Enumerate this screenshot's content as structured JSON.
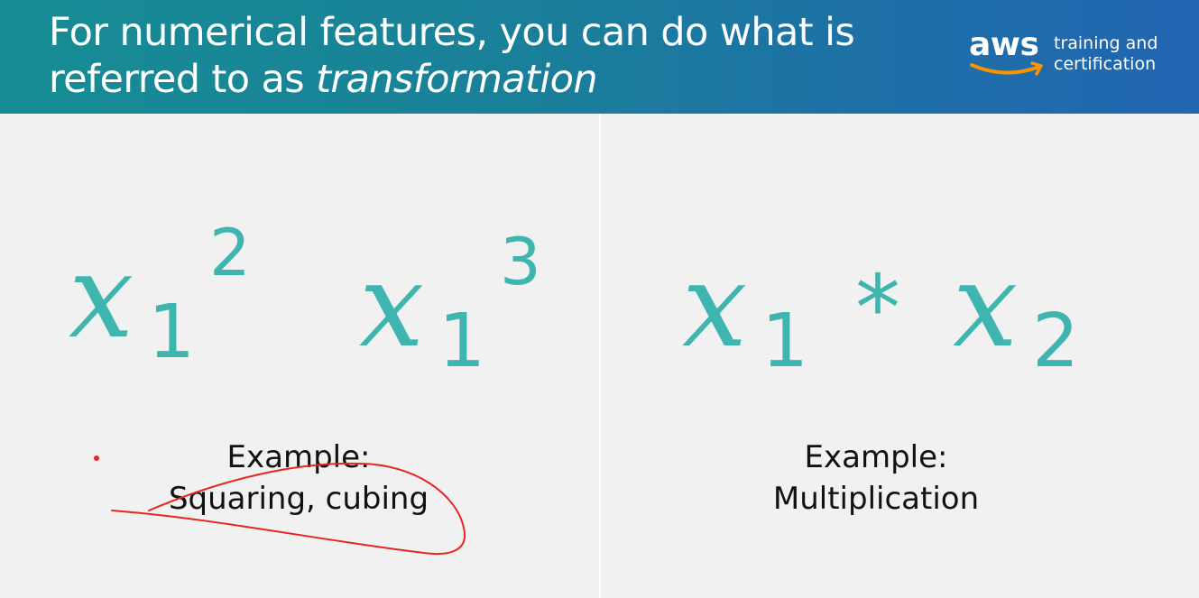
{
  "header": {
    "title_line1": "For numerical features, you can do what is",
    "title_line2_prefix": "referred to as ",
    "title_line2_emphasis": "transformation",
    "logo": {
      "brand": "aws",
      "tagline_line1": "training and",
      "tagline_line2": "certification",
      "smile_color": "#f79400"
    },
    "background_colors": [
      "#168d94",
      "#2165b1"
    ]
  },
  "left_panel": {
    "expr1": {
      "var": "x",
      "sub": "1",
      "sup": "2"
    },
    "expr2": {
      "var": "x",
      "sub": "1",
      "sup": "3"
    },
    "caption_line1": "Example:",
    "caption_line2": "Squaring, cubing"
  },
  "right_panel": {
    "expr": {
      "var1": "x",
      "sub1": "1",
      "op": "*",
      "var2": "x",
      "sub2": "2"
    },
    "caption_line1": "Example:",
    "caption_line2": "Multiplication"
  },
  "colors": {
    "math": "#3fb5b0",
    "annotation": "#e8251f",
    "panel_background": "#f1f1f2"
  }
}
